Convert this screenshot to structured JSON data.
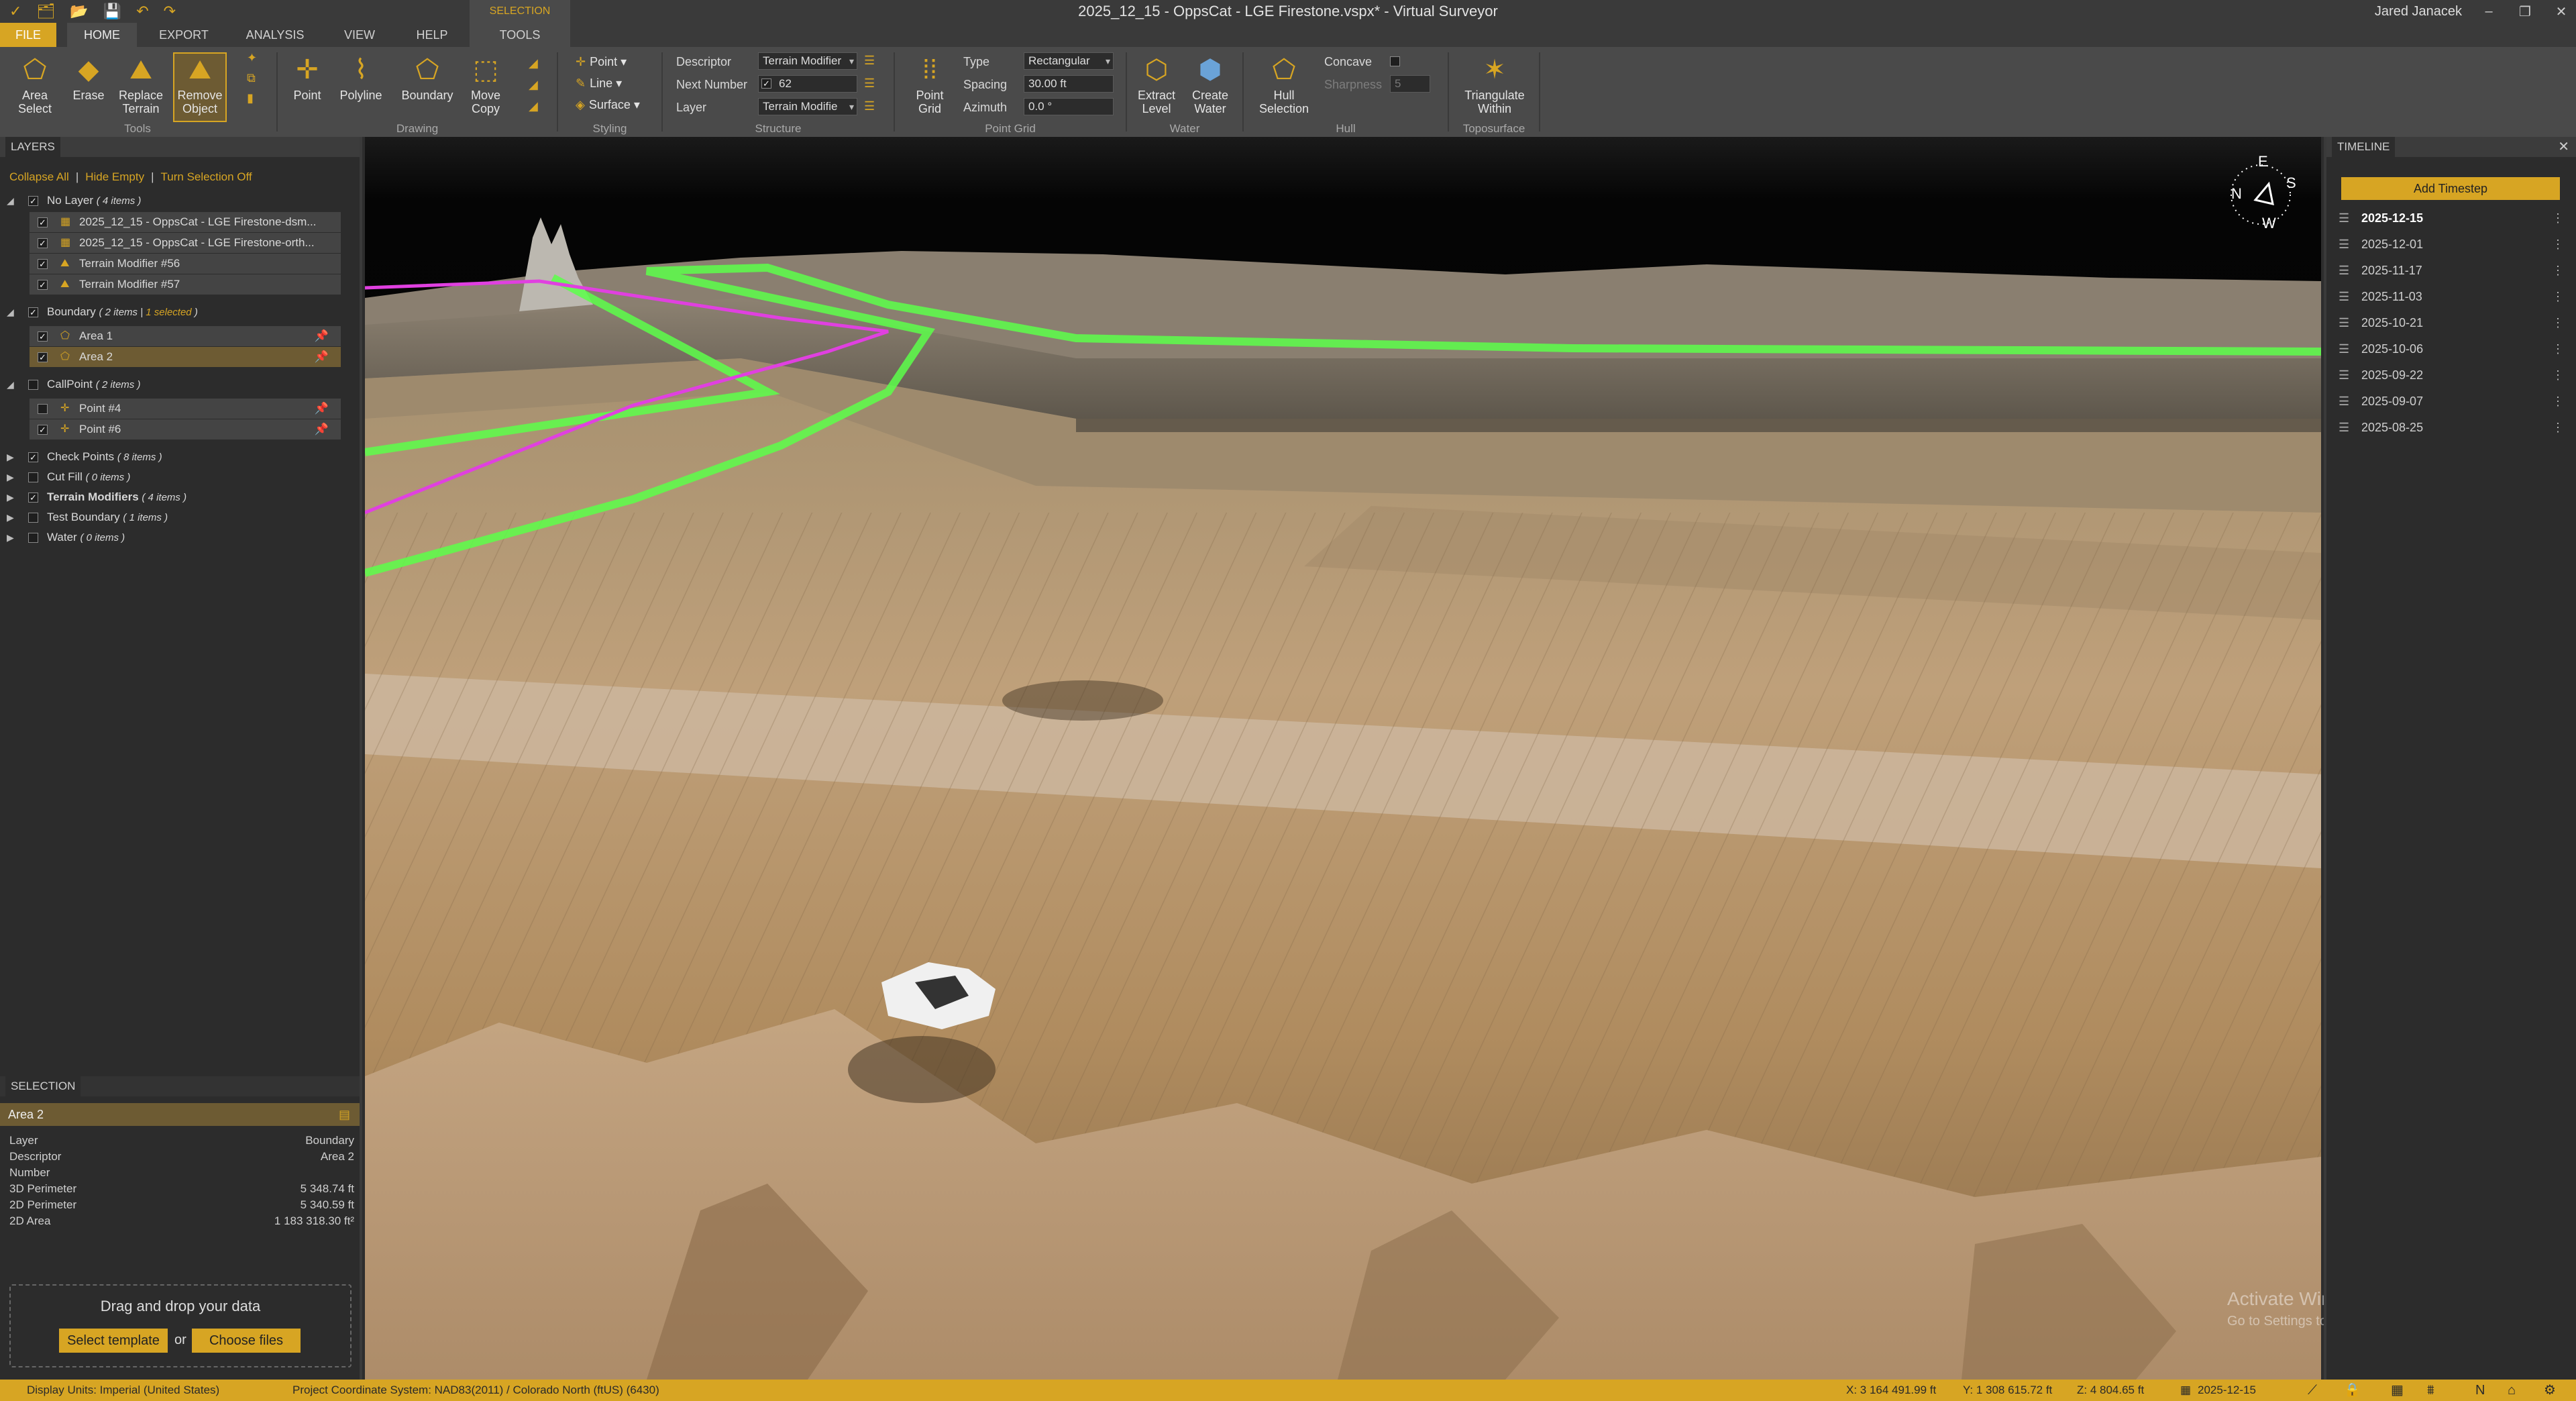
{
  "window": {
    "title": "2025_12_15 - OppsCat - LGE Firestone.vspx*  -  Virtual Surveyor",
    "user": "Jared Janacek",
    "quick_access": [
      "✓",
      "🗂",
      "📂",
      "💾",
      "↶",
      "↷"
    ],
    "controls": [
      "–",
      "❐",
      "✕"
    ]
  },
  "contextual_tab": {
    "group": "SELECTION",
    "label": "TOOLS"
  },
  "tabs": [
    "FILE",
    "HOME",
    "EXPORT",
    "ANALYSIS",
    "VIEW",
    "HELP"
  ],
  "ribbon": {
    "tools": {
      "label": "Tools",
      "buttons": [
        {
          "label": "Area\nSelect",
          "icon": "area-select-icon"
        },
        {
          "label": "Erase",
          "icon": "eraser-icon"
        },
        {
          "label": "Replace\nTerrain",
          "icon": "replace-terrain-icon"
        },
        {
          "label": "Remove\nObject",
          "icon": "remove-object-icon"
        }
      ]
    },
    "drawing": {
      "label": "Drawing",
      "buttons": [
        "Point",
        "Polyline",
        "Boundary",
        "Move\nCopy"
      ]
    },
    "styling": {
      "label": "Styling",
      "buttons": [
        "Point",
        "Line",
        "Surface"
      ]
    },
    "structure": {
      "label": "Structure",
      "descriptor_label": "Descriptor",
      "descriptor_value": "Terrain Modifier",
      "next_number_label": "Next Number",
      "next_number_value": "62",
      "layer_label": "Layer",
      "layer_value": "Terrain Modifie"
    },
    "point_grid": {
      "label": "Point Grid",
      "button": "Point\nGrid",
      "type_label": "Type",
      "type_value": "Rectangular",
      "spacing_label": "Spacing",
      "spacing_value": "30.00 ft",
      "azimuth_label": "Azimuth",
      "azimuth_value": "0.0 °"
    },
    "water": {
      "label": "Water",
      "buttons": [
        "Extract\nLevel",
        "Create\nWater"
      ]
    },
    "hull": {
      "label": "Hull",
      "button": "Hull\nSelection",
      "concave_label": "Concave",
      "sharpness_label": "Sharpness",
      "sharpness_value": "5"
    },
    "toposurface": {
      "label": "Toposurface",
      "button": "Triangulate\nWithin"
    }
  },
  "layers": {
    "tab": "LAYERS",
    "links": [
      "Collapse All",
      "Hide Empty",
      "Turn Selection Off"
    ],
    "groups": [
      {
        "name": "No Layer",
        "count": "( 4 items )",
        "checked": true,
        "expanded": true,
        "children": [
          {
            "name": "2025_12_15 - OppsCat - LGE Firestone-dsm...",
            "checked": true
          },
          {
            "name": "2025_12_15 - OppsCat - LGE Firestone-orth...",
            "checked": true
          },
          {
            "name": "Terrain Modifier #56",
            "checked": true
          },
          {
            "name": "Terrain Modifier #57",
            "checked": true
          }
        ]
      },
      {
        "name": "Boundary",
        "count": "( 2 items | ",
        "selected_note": "1 selected",
        "count_end": " )",
        "checked": true,
        "expanded": true,
        "children": [
          {
            "name": "Area 1",
            "checked": true
          },
          {
            "name": "Area 2",
            "checked": true,
            "selected": true
          }
        ]
      },
      {
        "name": "CallPoint",
        "count": "( 2 items )",
        "checked": false,
        "expanded": true,
        "children": [
          {
            "name": "Point #4",
            "checked": false
          },
          {
            "name": "Point #6",
            "checked": true
          }
        ]
      },
      {
        "name": "Check Points",
        "count": "( 8 items )",
        "checked": true,
        "expanded": false
      },
      {
        "name": "Cut Fill",
        "count": "( 0 items )",
        "checked": false,
        "expanded": false
      },
      {
        "name": "Terrain Modifiers",
        "count": "( 4 items )",
        "checked": true,
        "expanded": false,
        "bold": true
      },
      {
        "name": "Test Boundary",
        "count": "( 1 items )",
        "checked": false,
        "expanded": false
      },
      {
        "name": "Water",
        "count": "( 0 items )",
        "checked": false,
        "expanded": false
      }
    ]
  },
  "selection": {
    "tab": "SELECTION",
    "title": "Area 2",
    "props": [
      {
        "k": "Layer",
        "v": "Boundary"
      },
      {
        "k": "Descriptor",
        "v": "Area 2"
      },
      {
        "k": "Number",
        "v": ""
      },
      {
        "k": "3D Perimeter",
        "v": "5 348.74 ft"
      },
      {
        "k": "2D Perimeter",
        "v": "5 340.59 ft"
      },
      {
        "k": "2D Area",
        "v": "1 183 318.30 ft²"
      }
    ]
  },
  "dropzone": {
    "text": "Drag and drop your data",
    "select_template": "Select template",
    "or": "or",
    "choose_files": "Choose files"
  },
  "timeline": {
    "tab": "TIMELINE",
    "add_button": "Add Timestep",
    "dates": [
      "2025-12-15",
      "2025-12-01",
      "2025-11-17",
      "2025-11-03",
      "2025-10-21",
      "2025-10-06",
      "2025-09-22",
      "2025-09-07",
      "2025-08-25"
    ],
    "current": "2025-12-15"
  },
  "compass": {
    "n": "N",
    "e": "E",
    "s": "S",
    "w": "W"
  },
  "watermark": {
    "line1": "Activate Windows",
    "line2": "Go to Settings to activate Windows."
  },
  "statusbar": {
    "display_units": "Display Units:  Imperial (United States)",
    "crs": "Project Coordinate System:  NAD83(2011) / Colorado North (ftUS) (6430)",
    "x": "X: 3 164 491.99 ft",
    "y": "Y: 1 308 615.72 ft",
    "z": "Z: 4 804.65 ft",
    "date": "2025-12-15"
  },
  "colors": {
    "accent": "#d7a523",
    "panel": "#2c2c2c",
    "ribbon": "#4a4a4a",
    "boundary_line": "#e040e0",
    "green_line": "#5cff4a"
  }
}
